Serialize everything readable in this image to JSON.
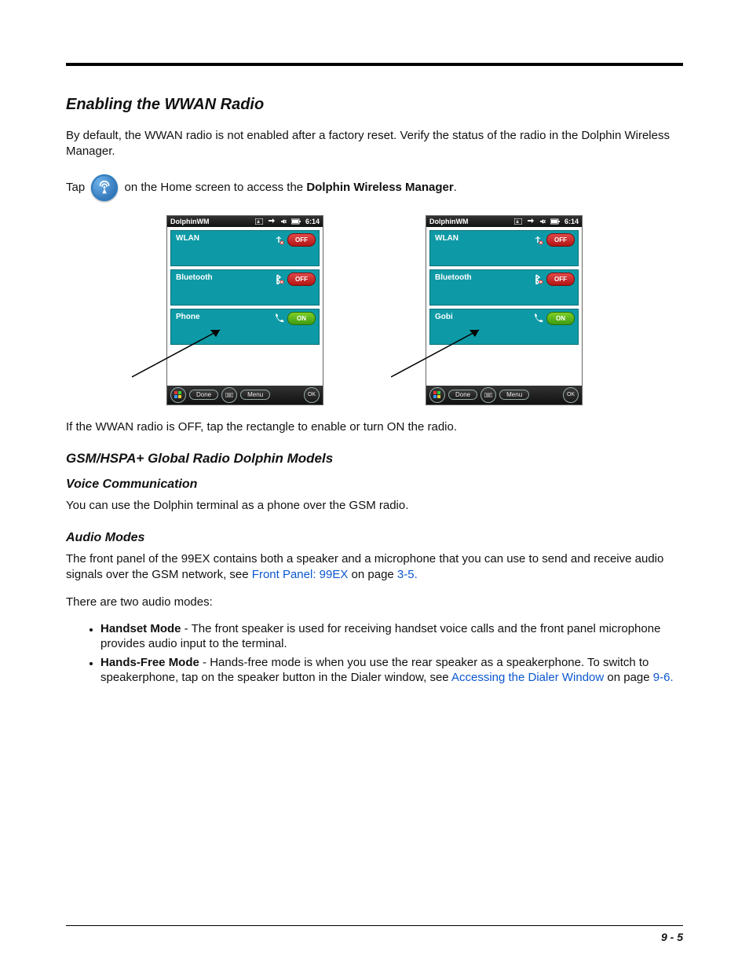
{
  "headings": {
    "h1": "Enabling the WWAN Radio",
    "h2": "GSM/HSPA+ Global Radio Dolphin Models",
    "h3": "Voice Communication",
    "h4": "Audio Modes"
  },
  "paragraphs": {
    "intro": "By default, the WWAN radio is not enabled after a factory reset. Verify the status of the radio in the Dolphin Wireless Manager.",
    "tap_prefix": "Tap",
    "tap_suffix_a": " on the Home screen to access the ",
    "tap_bold": "Dolphin Wireless Manager",
    "tap_suffix_b": ".",
    "after_shots": "If the WWAN radio is OFF, tap the rectangle to enable or turn ON the radio.",
    "voice_body": "You can use the Dolphin terminal as a phone over the GSM radio.",
    "audio_intro_a": "The front panel of the 99EX contains both a speaker and a microphone that you can use to send and receive audio signals over the GSM network, see ",
    "audio_link1": "Front Panel: 99EX",
    "audio_intro_b": " on page ",
    "audio_link2": "3-5.",
    "audio_two": "There are two audio modes:"
  },
  "bullets": {
    "handset_label": "Handset Mode",
    "handset_body": " - The front speaker is used for receiving handset voice calls and the front panel microphone provides audio input to the terminal.",
    "handsfree_label": "Hands-Free Mode",
    "handsfree_body_a": " - Hands-free mode is when you use the rear speaker as a speakerphone. To switch to speakerphone, tap on the speaker button in the Dialer window, see ",
    "handsfree_link": "Accessing the Dialer Window",
    "handsfree_body_b": " on page ",
    "handsfree_link2": "9-6.",
    "handsfree_tail": ""
  },
  "screenshots": {
    "status": {
      "title": "DolphinWM",
      "time": "6:14"
    },
    "left": {
      "tiles": [
        {
          "label": "WLAN",
          "state": "OFF"
        },
        {
          "label": "Bluetooth",
          "state": "OFF"
        },
        {
          "label": "Phone",
          "state": "ON"
        }
      ]
    },
    "right": {
      "tiles": [
        {
          "label": "WLAN",
          "state": "OFF"
        },
        {
          "label": "Bluetooth",
          "state": "OFF"
        },
        {
          "label": "Gobi",
          "state": "ON"
        }
      ]
    },
    "bottombar": {
      "done": "Done",
      "menu": "Menu",
      "ok": "OK"
    }
  },
  "page_num": "9 - 5"
}
